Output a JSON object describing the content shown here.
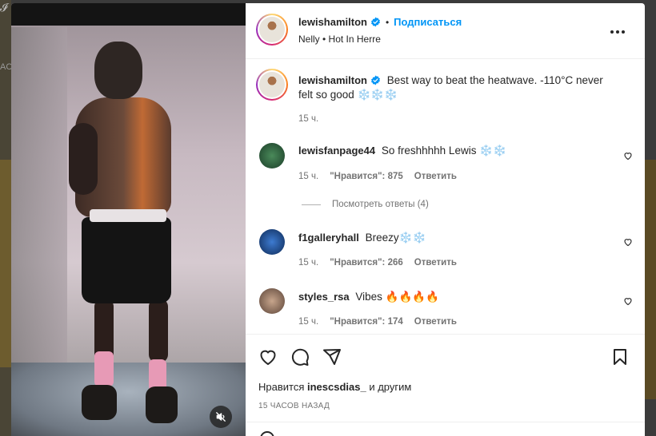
{
  "background": {
    "left_text": "AC"
  },
  "post": {
    "author": "lewishamilton",
    "follow_label": "Подписаться",
    "audio": "Nelly • Hot In Herre",
    "caption_user": "lewishamilton",
    "caption_text": "Best way to beat the heatwave. -110°C never felt so good ❄️❄️❄️",
    "caption_time": "15 ч."
  },
  "comments": [
    {
      "user": "lewisfanpage44",
      "text": "So freshhhhh Lewis ❄️❄️",
      "time": "15 ч.",
      "likes": "\"Нравится\": 875",
      "reply": "Ответить",
      "avatar_color": "#2e5a3c"
    },
    {
      "user": "f1galleryhall",
      "text": "Breezy❄️❄️",
      "time": "15 ч.",
      "likes": "\"Нравится\": 266",
      "reply": "Ответить",
      "avatar_color": "#1f4e8f"
    },
    {
      "user": "styles_rsa",
      "text": "Vibes 🔥🔥🔥🔥",
      "time": "15 ч.",
      "likes": "\"Нравится\": 174",
      "reply": "Ответить",
      "avatar_color": "#8b6e5a"
    }
  ],
  "view_replies": "Посмотреть ответы (4)",
  "likes_prefix": "Нравится",
  "likes_user": "inescsdias_",
  "likes_suffix": "и другим",
  "posted_ago": "15 ЧАСОВ НАЗАД",
  "icons": {
    "like": "heart-icon",
    "comment": "comment-icon",
    "share": "send-icon",
    "save": "bookmark-icon",
    "more": "more-icon",
    "mute": "mute-icon",
    "verified": "verified-icon"
  },
  "colors": {
    "link": "#0095f6",
    "verified": "#0095f6",
    "secondary": "#737373"
  }
}
